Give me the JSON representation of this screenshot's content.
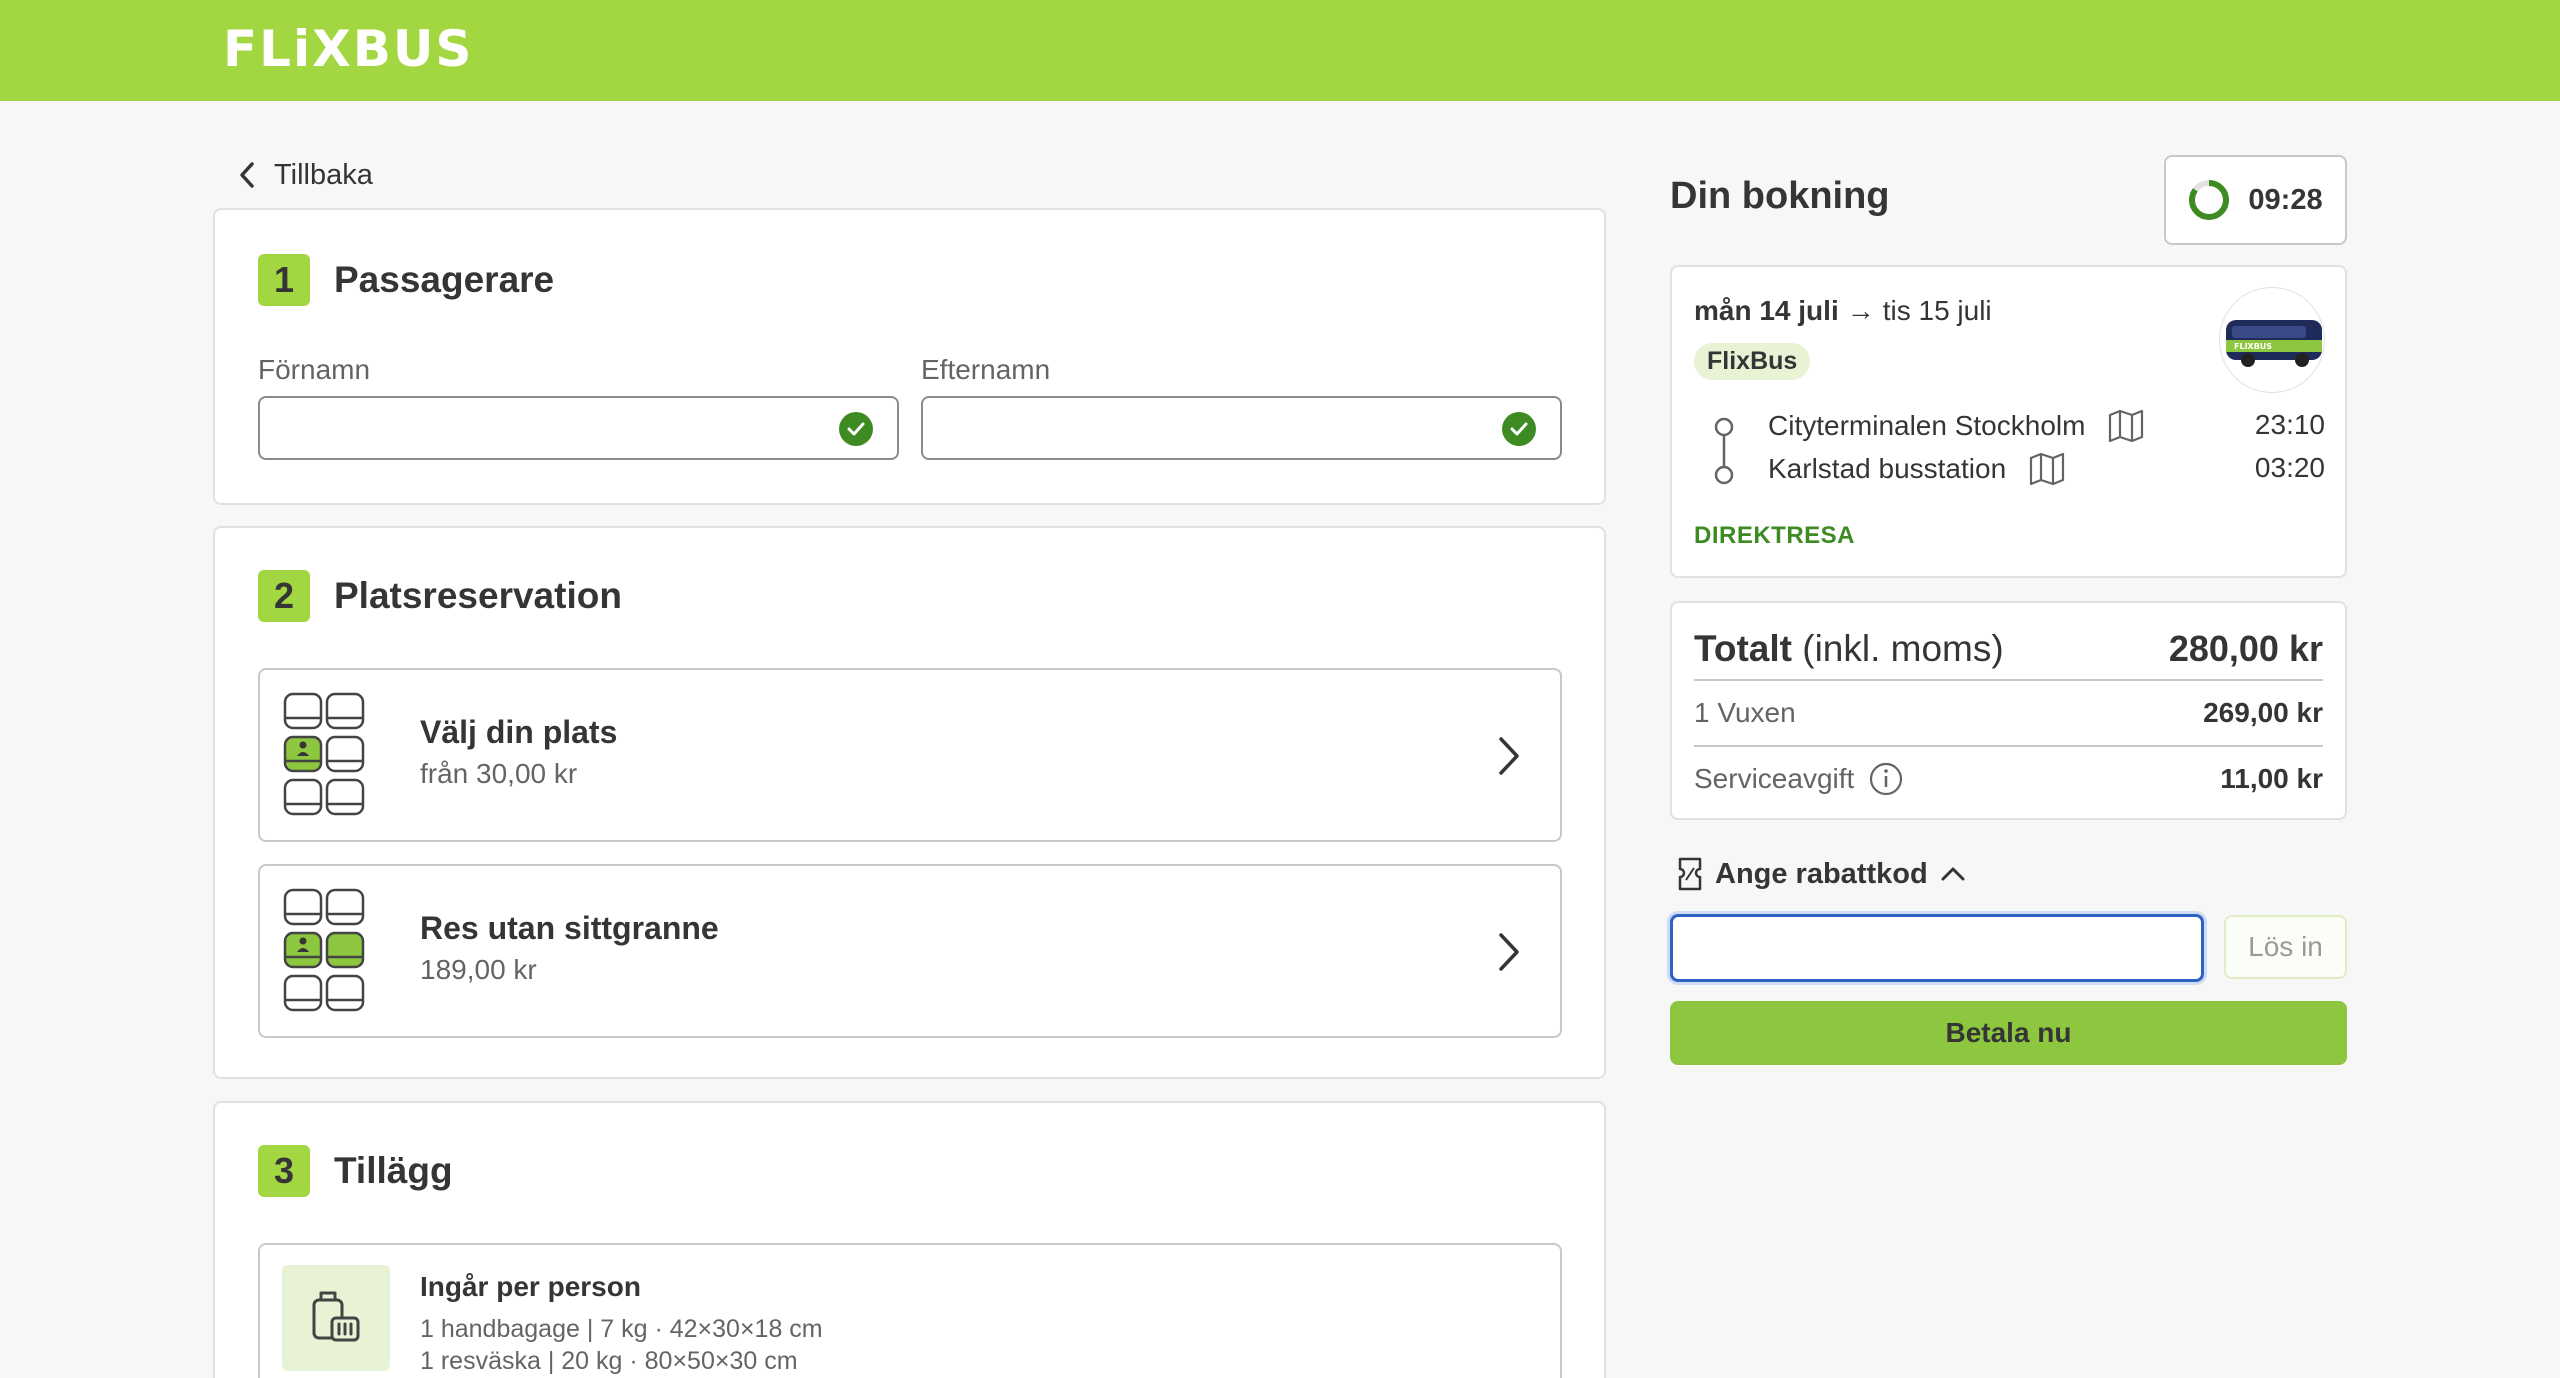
{
  "header": {
    "logo_text": "FLiXBUS",
    "brand_color": "#a3d742"
  },
  "nav": {
    "back_label": "Tillbaka"
  },
  "passengers": {
    "step_number": "1",
    "title": "Passagerare",
    "first_name_label": "Förnamn",
    "first_name_value": "",
    "last_name_label": "Efternamn",
    "last_name_value": ""
  },
  "seats": {
    "step_number": "2",
    "title": "Platsreservation",
    "options": [
      {
        "title": "Välj din plats",
        "subtitle": "från 30,00 kr"
      },
      {
        "title": "Res utan sittgranne",
        "subtitle": "189,00 kr"
      }
    ]
  },
  "addons": {
    "step_number": "3",
    "title": "Tillägg",
    "included_title": "Ingår per person",
    "lines": [
      "1 handbagage | 7 kg · 42×30×18 cm",
      "1 resväska | 20 kg · 80×50×30 cm"
    ]
  },
  "booking": {
    "title": "Din bokning",
    "timer": "09:28",
    "timer_progress": 0.85,
    "depart_date": "mån 14 juli",
    "arrow": "→",
    "arrive_date": "tis 15 juli",
    "operator": "FlixBus",
    "bus_logo_text": "FLIXBUS",
    "from_stop": "Cityterminalen Stockholm",
    "from_time": "23:10",
    "to_stop": "Karlstad busstation",
    "to_time": "03:20",
    "trip_type": "DIREKTRESA"
  },
  "price": {
    "total_label_bold": "Totalt",
    "total_label_rest": " (inkl. moms)",
    "total_value": "280,00 kr",
    "items": [
      {
        "label": "1 Vuxen",
        "value": "269,00 kr"
      },
      {
        "label": "Serviceavgift",
        "value": "11,00 kr"
      }
    ]
  },
  "coupon": {
    "toggle_label": "Ange rabattkod",
    "input_value": "",
    "redeem_label": "Lös in"
  },
  "pay": {
    "label": "Betala nu"
  }
}
